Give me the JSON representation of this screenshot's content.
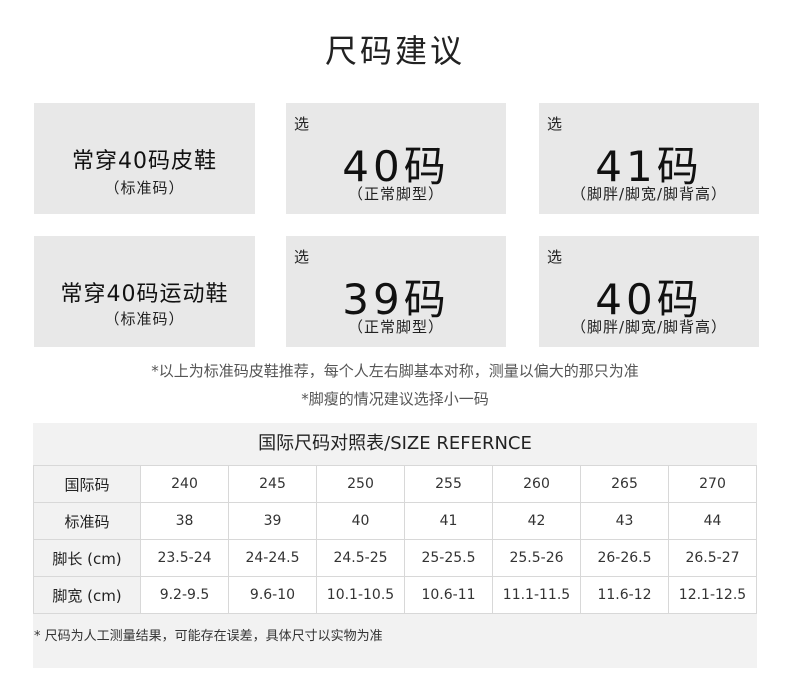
{
  "title": "尺码建议",
  "rows": [
    {
      "label": "常穿40码皮鞋",
      "label_sub": "（标准码）",
      "options": [
        {
          "tag": "选",
          "size": "40码",
          "desc": "（正常脚型）"
        },
        {
          "tag": "选",
          "size": "41码",
          "desc": "（脚胖/脚宽/脚背高）"
        }
      ]
    },
    {
      "label": "常穿40码运动鞋",
      "label_sub": "（标准码）",
      "options": [
        {
          "tag": "选",
          "size": "39码",
          "desc": "（正常脚型）"
        },
        {
          "tag": "选",
          "size": "40码",
          "desc": "（脚胖/脚宽/脚背高）"
        }
      ]
    }
  ],
  "notes": [
    "*以上为标准码皮鞋推荐，每个人左右脚基本对称，测量以偏大的那只为准",
    "*脚瘦的情况建议选择小一码"
  ],
  "table": {
    "title": "国际尺码对照表/SIZE REFERNCE",
    "rows": [
      {
        "header": "国际码",
        "values": [
          "240",
          "245",
          "250",
          "255",
          "260",
          "265",
          "270"
        ]
      },
      {
        "header": "标准码",
        "values": [
          "38",
          "39",
          "40",
          "41",
          "42",
          "43",
          "44"
        ]
      },
      {
        "header": "脚长 (cm)",
        "values": [
          "23.5-24",
          "24-24.5",
          "24.5-25",
          "25-25.5",
          "25.5-26",
          "26-26.5",
          "26.5-27"
        ]
      },
      {
        "header": "脚宽 (cm)",
        "values": [
          "9.2-9.5",
          "9.6-10",
          "10.1-10.5",
          "10.6-11",
          "11.1-11.5",
          "11.6-12",
          "12.1-12.5"
        ]
      }
    ],
    "footnote": "* 尺码为人工测量结果，可能存在误差，具体尺寸以实物为准"
  }
}
